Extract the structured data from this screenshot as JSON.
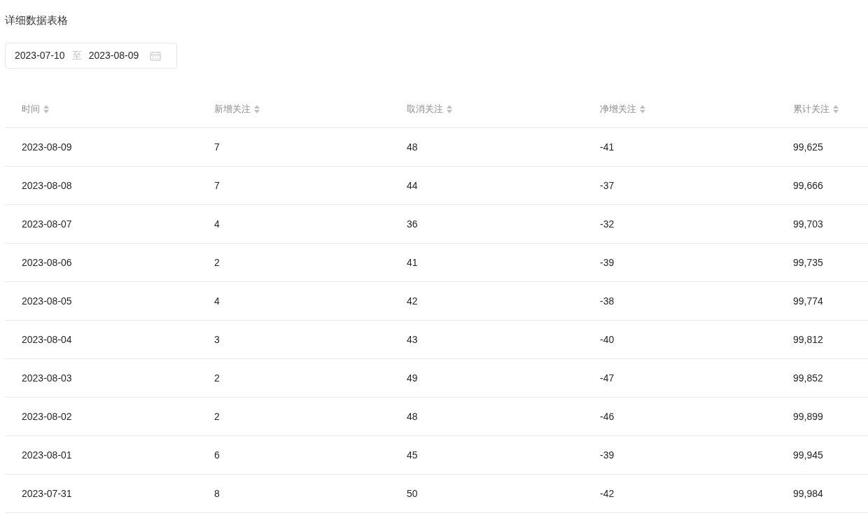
{
  "title": "详细数据表格",
  "date_range": {
    "start": "2023-07-10",
    "separator": "至",
    "end": "2023-08-09"
  },
  "table": {
    "columns": [
      "时间",
      "新增关注",
      "取消关注",
      "净增关注",
      "累计关注"
    ],
    "rows": [
      {
        "cells": [
          "2023-08-09",
          "7",
          "48",
          "-41",
          "99,625"
        ]
      },
      {
        "cells": [
          "2023-08-08",
          "7",
          "44",
          "-37",
          "99,666"
        ]
      },
      {
        "cells": [
          "2023-08-07",
          "4",
          "36",
          "-32",
          "99,703"
        ]
      },
      {
        "cells": [
          "2023-08-06",
          "2",
          "41",
          "-39",
          "99,735"
        ]
      },
      {
        "cells": [
          "2023-08-05",
          "4",
          "42",
          "-38",
          "99,774"
        ]
      },
      {
        "cells": [
          "2023-08-04",
          "3",
          "43",
          "-40",
          "99,812"
        ]
      },
      {
        "cells": [
          "2023-08-03",
          "2",
          "49",
          "-47",
          "99,852"
        ]
      },
      {
        "cells": [
          "2023-08-02",
          "2",
          "48",
          "-46",
          "99,899"
        ]
      },
      {
        "cells": [
          "2023-08-01",
          "6",
          "45",
          "-39",
          "99,945"
        ]
      },
      {
        "cells": [
          "2023-07-31",
          "8",
          "50",
          "-42",
          "99,984"
        ]
      }
    ]
  }
}
